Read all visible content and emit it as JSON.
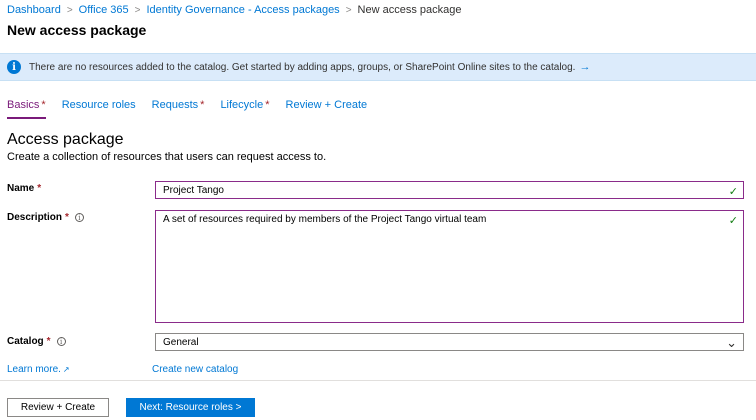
{
  "breadcrumb": {
    "items": [
      "Dashboard",
      "Office 365",
      "Identity Governance - Access packages"
    ],
    "current": "New access package",
    "separator": ">"
  },
  "page": {
    "title": "New access package"
  },
  "info_bar": {
    "icon": "info-icon",
    "message": "There are no resources added to the catalog. Get started by adding apps, groups, or SharePoint Online sites to the catalog.",
    "arrow": "→"
  },
  "tabs": [
    {
      "label": "Basics",
      "required": "*"
    },
    {
      "label": "Resource roles",
      "required": ""
    },
    {
      "label": "Requests",
      "required": "*"
    },
    {
      "label": "Lifecycle",
      "required": "*"
    },
    {
      "label": "Review + Create",
      "required": ""
    }
  ],
  "section": {
    "title": "Access package",
    "subtitle": "Create a collection of resources that users can request access to."
  },
  "form": {
    "name": {
      "label": "Name",
      "required": "*",
      "value": "Project Tango"
    },
    "description": {
      "label": "Description",
      "required": "*",
      "value": "A set of resources required by members of the Project Tango virtual team"
    },
    "catalog": {
      "label": "Catalog",
      "required": "*",
      "value": "General"
    }
  },
  "links": {
    "learn_more": "Learn more.",
    "create_catalog": "Create new catalog"
  },
  "footer": {
    "review_button": "Review + Create",
    "next_button": "Next: Resource roles >"
  },
  "colors": {
    "accent": "#0078d4",
    "active_tab": "#7a1a7a",
    "info_bar_bg": "#dcebfb",
    "valid_check": "#107c10",
    "required": "#a4262c"
  }
}
